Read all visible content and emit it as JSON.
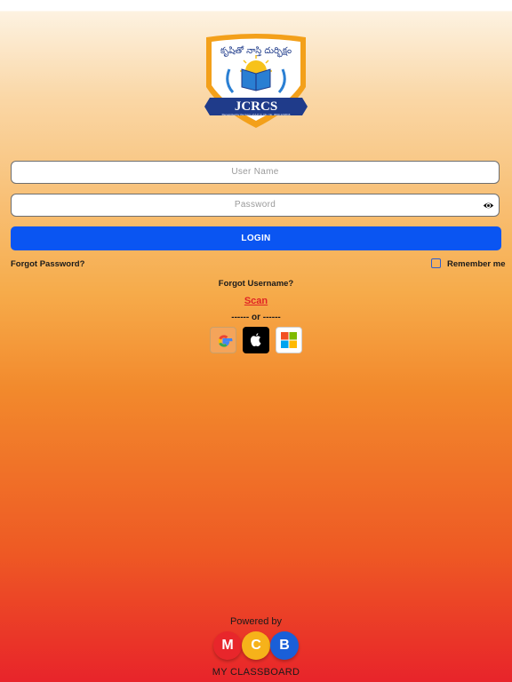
{
  "logo": {
    "top_text": "కృషితో నాస్తి దుర్భిక్షం",
    "name": "JCRCS",
    "subtext": "Recognized by the Govt. of A.P. D. Dis. No: 4003-12/2016"
  },
  "form": {
    "username_placeholder": "User Name",
    "password_placeholder": "Password",
    "login_label": "LOGIN",
    "forgot_password": "Forgot Password?",
    "remember_me": "Remember me",
    "forgot_username": "Forgot Username?",
    "scan": "Scan",
    "or_divider": "------ or ------"
  },
  "social": [
    {
      "icon": "google-icon"
    },
    {
      "icon": "apple-icon"
    },
    {
      "icon": "microsoft-icon"
    }
  ],
  "footer": {
    "powered_by": "Powered by",
    "letters": [
      "M",
      "C",
      "B"
    ],
    "brand": "MY CLASSBOARD"
  },
  "colors": {
    "login_button": "#0a55f2",
    "scan_link": "#e02424"
  }
}
